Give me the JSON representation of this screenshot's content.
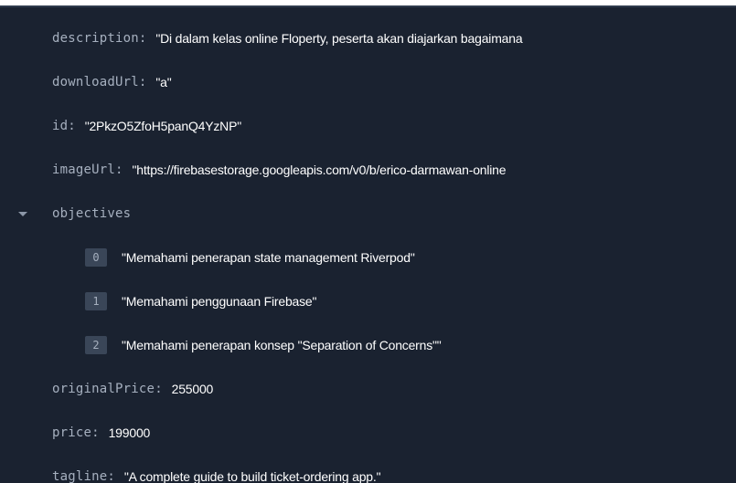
{
  "fields": {
    "description": {
      "key": "description",
      "value": "\"Di dalam kelas online Floperty, peserta akan diajarkan bagaimana"
    },
    "downloadUrl": {
      "key": "downloadUrl",
      "value": "\"a\""
    },
    "id": {
      "key": "id",
      "value": "\"2PkzO5ZfoH5panQ4YzNP\""
    },
    "imageUrl": {
      "key": "imageUrl",
      "value": "\"https://firebasestorage.googleapis.com/v0/b/erico-darmawan-online"
    },
    "objectives": {
      "key": "objectives",
      "items": [
        {
          "index": "0",
          "value": "\"Memahami penerapan state management Riverpod\""
        },
        {
          "index": "1",
          "value": "\"Memahami penggunaan Firebase\""
        },
        {
          "index": "2",
          "value": "\"Memahami penerapan konsep \"Separation of Concerns\"\""
        }
      ]
    },
    "originalPrice": {
      "key": "originalPrice",
      "value": "255000"
    },
    "price": {
      "key": "price",
      "value": "199000"
    },
    "tagline": {
      "key": "tagline",
      "value": "\"A complete guide to build ticket-ordering app.\""
    }
  },
  "colors": {
    "background": "#1a2230",
    "key_text": "#a6b0bf",
    "value_text": "#ffffff",
    "index_badge": "#3a4658"
  },
  "icons": {
    "objectives_toggle": "caret-down-icon"
  }
}
